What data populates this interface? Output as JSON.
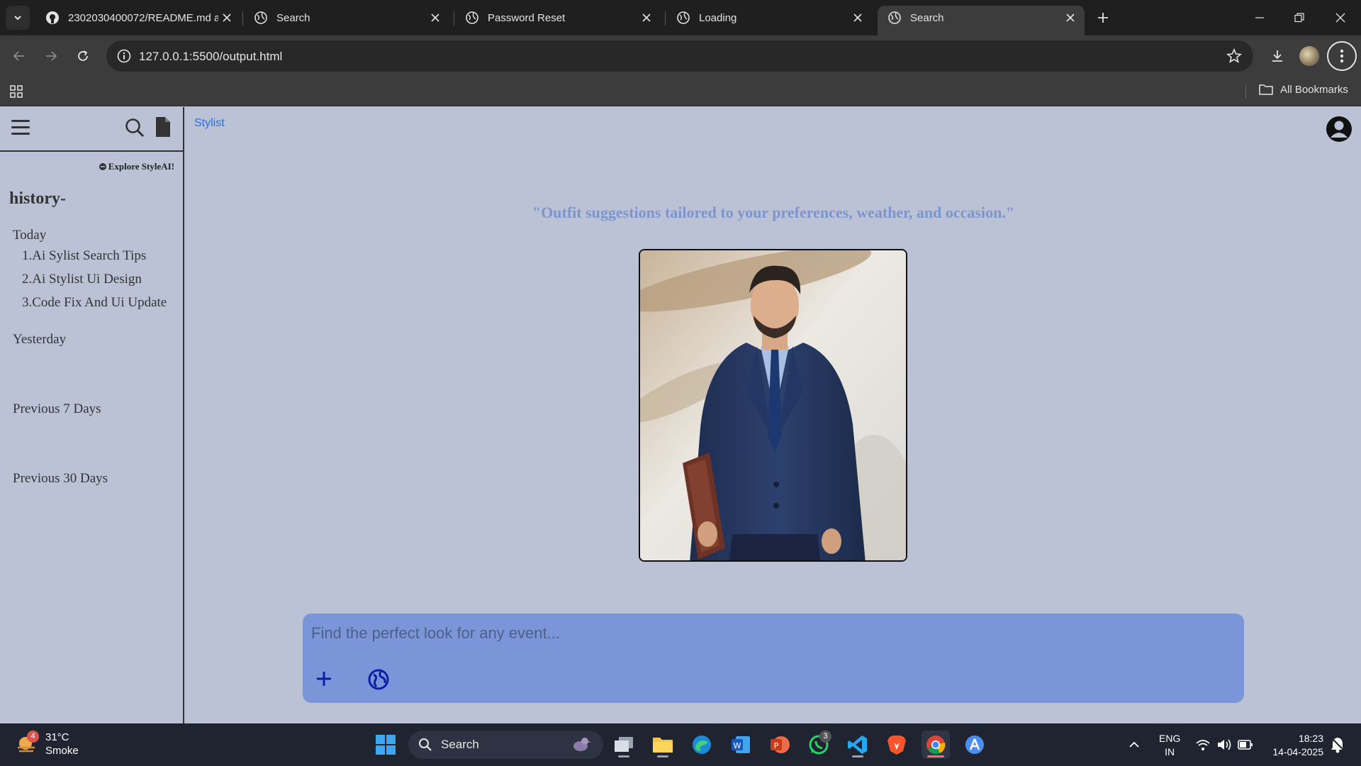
{
  "browser": {
    "tabs": [
      {
        "title": "2302030400072/README.md at",
        "favicon": "github-icon",
        "active": false
      },
      {
        "title": "Search",
        "favicon": "globe-icon",
        "active": false
      },
      {
        "title": "Password Reset",
        "favicon": "globe-icon",
        "active": false
      },
      {
        "title": "Loading",
        "favicon": "globe-icon",
        "active": false
      },
      {
        "title": "Search",
        "favicon": "globe-icon",
        "active": true
      }
    ],
    "url": "127.0.0.1:5500/output.html",
    "bookmarks_label": "All Bookmarks"
  },
  "sidebar": {
    "explore_label": "Explore StyleAI!",
    "history_title": "history-",
    "sections": [
      {
        "label": "Today",
        "items": [
          "1.Ai Sylist Search Tips",
          "2.Ai Stylist Ui Design",
          "3.Code Fix And Ui Update"
        ]
      },
      {
        "label": "Yesterday",
        "items": []
      },
      {
        "label": "Previous 7 Days",
        "items": []
      },
      {
        "label": "Previous 30 Days",
        "items": []
      }
    ]
  },
  "main": {
    "brand": "Stylist",
    "tagline": "\"Outfit suggestions tailored to your preferences, weather, and occasion.\"",
    "chat_placeholder": "Find the perfect look for any event..."
  },
  "taskbar": {
    "weather_temp": "31°C",
    "weather_desc": "Smoke",
    "weather_badge": "4",
    "search_label": "Search",
    "whatsapp_badge": "3",
    "lang_line1": "ENG",
    "lang_line2": "IN",
    "time": "18:23",
    "date": "14-04-2025"
  },
  "colors": {
    "page_bg": "#bcc2d6",
    "accent_blue": "#2c6fd6",
    "tagline": "#7b95cf",
    "chatbox": "#7b96d8"
  }
}
